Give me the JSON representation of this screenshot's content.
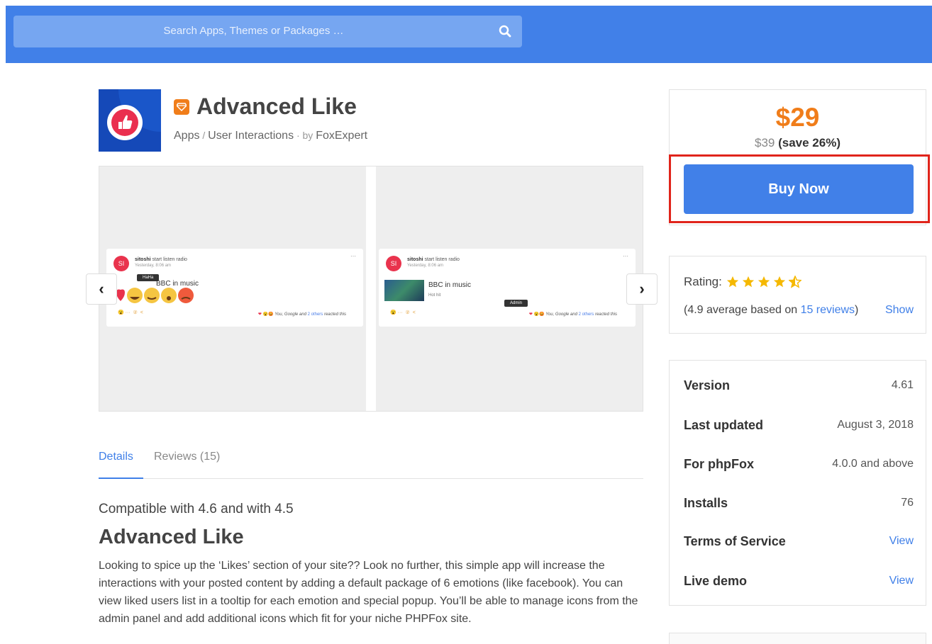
{
  "search": {
    "placeholder": "Search Apps, Themes or Packages …"
  },
  "app": {
    "title": "Advanced Like",
    "breadcrumb_category": "Apps",
    "breadcrumb_separator": " / ",
    "breadcrumb_sub": "User Interactions",
    "by_label": " · by ",
    "author": "FoxExpert"
  },
  "gallery": {
    "left": {
      "avatar": "SI",
      "user": "sitoshi",
      "action": "start listen radio",
      "time": "Yesterday, 8:06 am",
      "tooltip": "HaHa",
      "post_title": "BBC in music",
      "reacted_text": "You, Google and",
      "reacted_link": "2 others",
      "reacted_suffix": "reacted this"
    },
    "right": {
      "avatar": "SI",
      "user": "sitoshi",
      "action": "start listen radio",
      "time": "Yesterday, 8:06 am",
      "tooltip": "Admin",
      "post_title": "BBC in music",
      "post_sub": "Hot hit",
      "reacted_text": "You, Google and",
      "reacted_link": "2 others",
      "reacted_suffix": "reacted this"
    },
    "prev_glyph": "‹",
    "next_glyph": "›"
  },
  "tabs": [
    {
      "label": "Details",
      "active": true
    },
    {
      "label": "Reviews (15)",
      "active": false
    }
  ],
  "details": {
    "compat": "Compatible with 4.6 and with 4.5",
    "heading": "Advanced Like",
    "body": "Looking to spice up the ‘Likes’ section of your site?? Look no further, this simple app will increase the interactions with your posted content by adding a default package of 6 emotions (like facebook). You can view liked users list in a tooltip for each emotion and special popup. You’ll be able to manage icons from the admin panel and add additional icons which fit for your niche PHPFox site."
  },
  "pricing": {
    "price": "$29",
    "old_price": "$39",
    "save": "(save 26%)",
    "buy_label": "Buy Now"
  },
  "rating": {
    "label": "Rating:",
    "value": 4.5,
    "summary_prefix": "(4.9 average based on ",
    "reviews_link": "15 reviews",
    "summary_suffix": ")",
    "show_label": "Show"
  },
  "info": [
    {
      "key": "Version",
      "value": "4.61",
      "link": false
    },
    {
      "key": "Last updated",
      "value": "August 3, 2018",
      "link": false
    },
    {
      "key": "For phpFox",
      "value": "4.0.0 and above",
      "link": false
    },
    {
      "key": "Installs",
      "value": "76",
      "link": false
    },
    {
      "key": "Terms of Service",
      "value": "View",
      "link": true
    },
    {
      "key": "Live demo",
      "value": "View",
      "link": true
    }
  ],
  "colors": {
    "brand_blue": "#4180e8",
    "accent_orange": "#f07d1a",
    "highlight_red": "#e0241b",
    "star_yellow": "#f5b800"
  }
}
